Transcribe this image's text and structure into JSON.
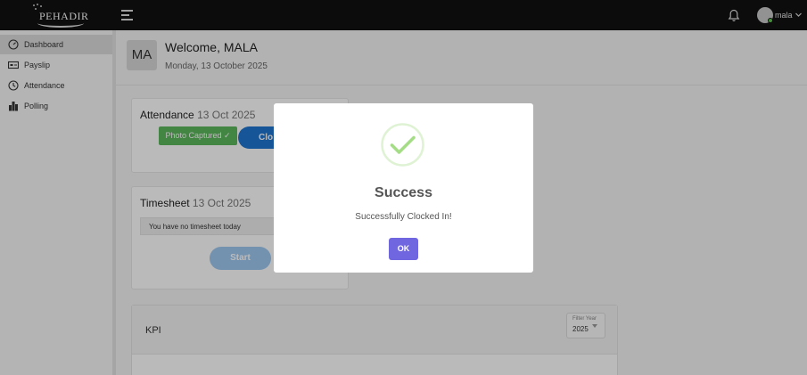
{
  "header": {
    "logo_text": "PEHADIR",
    "menu_icon": "hamburger-icon",
    "notification_icon": "bell-icon",
    "user_name": "mala",
    "status_color": "#5fc451"
  },
  "sidebar": {
    "items": [
      {
        "label": "Dashboard",
        "icon": "gauge-icon",
        "active": true
      },
      {
        "label": "Payslip",
        "icon": "payslip-icon",
        "active": false
      },
      {
        "label": "Attendance",
        "icon": "clock-icon",
        "active": false
      },
      {
        "label": "Polling",
        "icon": "bar-chart-icon",
        "active": false
      }
    ]
  },
  "welcome": {
    "initials": "MA",
    "title": "Welcome, MALA",
    "date": "Monday, 13 October 2025"
  },
  "attendance": {
    "title": "Attendance",
    "date": "13 Oct 2025",
    "photo_status": "Photo Captured ✓",
    "clock_button": "Clo"
  },
  "timesheet": {
    "title": "Timesheet",
    "date": "13 Oct 2025",
    "message": "You have no timesheet today",
    "start_button": "Start"
  },
  "kpi": {
    "title": "KPI",
    "filter_label": "Filter Year",
    "filter_value": "2025"
  },
  "modal": {
    "icon": "success-check-icon",
    "title": "Success",
    "message": "Successfully Clocked In!",
    "ok_button": "OK"
  },
  "colors": {
    "topbar": "#111111",
    "ok_button": "#7066e0",
    "clock_button": "#1f75d1",
    "photo_badge": "#5cb85c",
    "success_ring": "#a5dc86"
  }
}
